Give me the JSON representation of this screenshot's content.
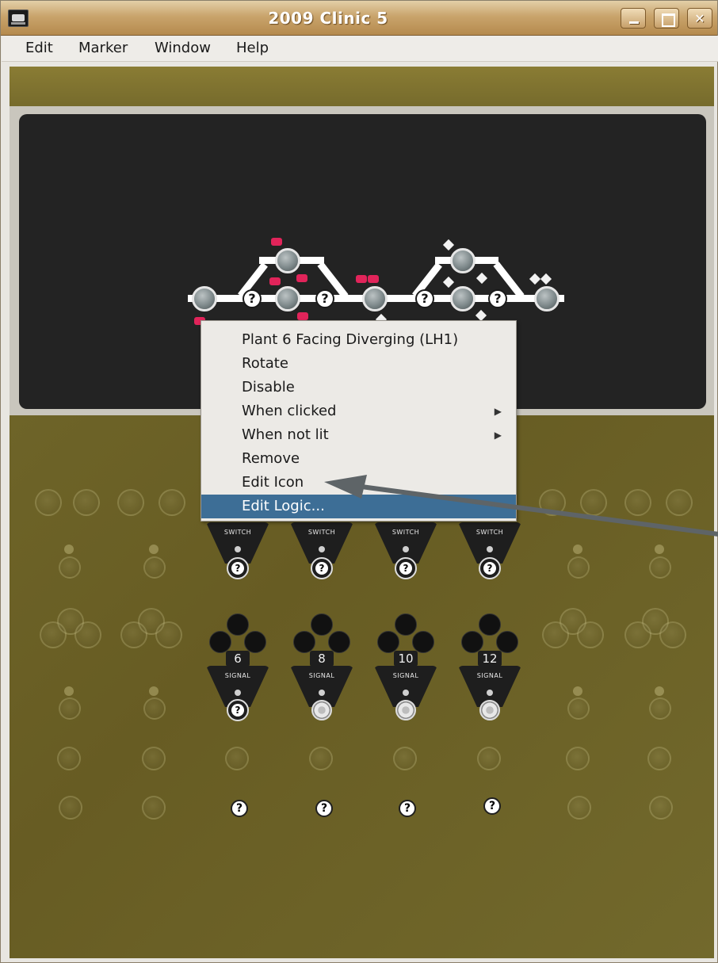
{
  "window": {
    "title": "2009 Clinic 5"
  },
  "menubar": {
    "items": [
      "Edit",
      "Marker",
      "Window",
      "Help"
    ]
  },
  "context_menu": {
    "items": [
      {
        "label": "Plant 6 Facing Diverging (LH1)",
        "submenu": false,
        "selected": false
      },
      {
        "label": "Rotate",
        "submenu": false,
        "selected": false
      },
      {
        "label": "Disable",
        "submenu": false,
        "selected": false
      },
      {
        "label": "When clicked",
        "submenu": true,
        "selected": false
      },
      {
        "label": "When not lit",
        "submenu": true,
        "selected": false
      },
      {
        "label": "Remove",
        "submenu": false,
        "selected": false
      },
      {
        "label": "Edit Icon",
        "submenu": false,
        "selected": false
      },
      {
        "label": "Edit Logic...",
        "submenu": false,
        "selected": true
      }
    ],
    "submenu_arrow": "▶"
  },
  "controls": {
    "switch_label": "SWITCH",
    "signal_label": "SIGNAL",
    "signal_numbers": [
      "6",
      "8",
      "10",
      "12"
    ],
    "unknown_state_glyph": "?"
  },
  "colors": {
    "titlebar": "#c9a46c",
    "panel": "#6d6227",
    "screen": "#232323",
    "selection": "#3d6e96",
    "indicator_red": "#e1245a"
  }
}
